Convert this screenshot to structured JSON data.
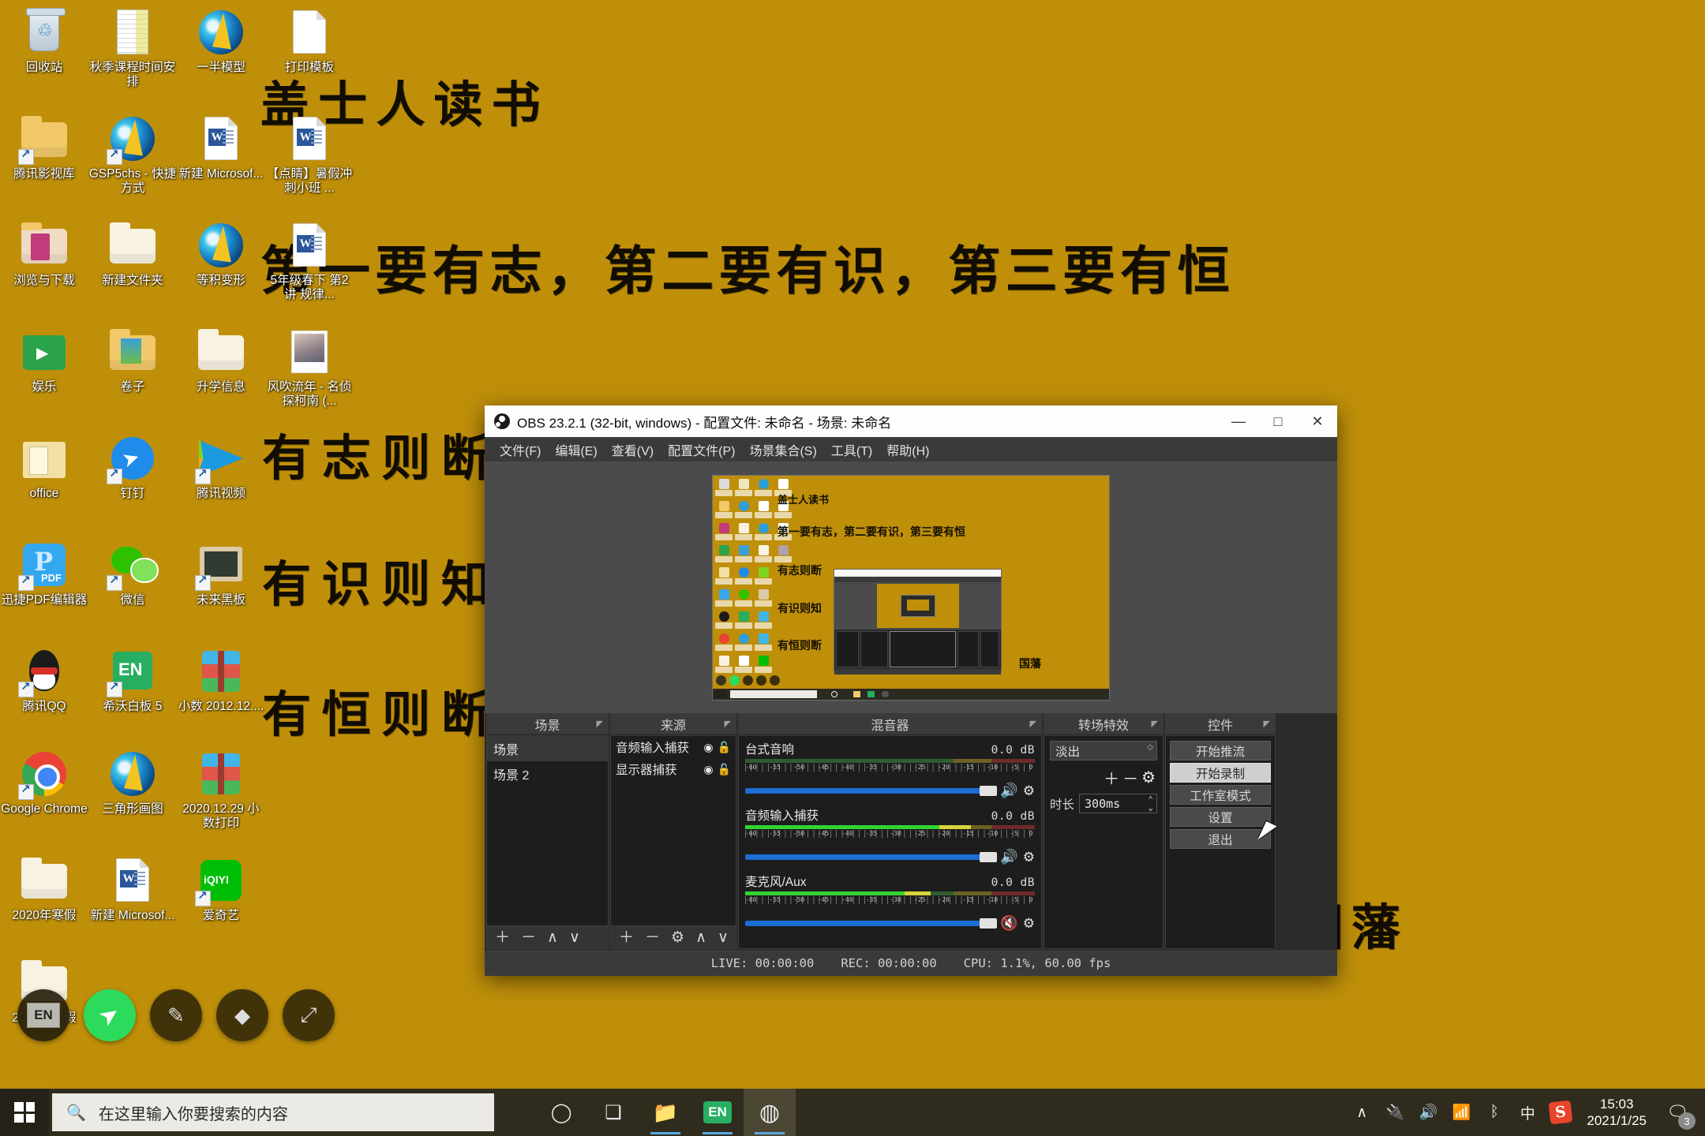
{
  "desktop": {
    "wallpaper_color": "#bf8f0a",
    "calligraphy": {
      "title": "盖士人读书",
      "line1": "第一要有志，第二要有识，第三要有恒",
      "line2": "有志则断",
      "line3": "有识则知",
      "line4": "有恒则断",
      "signature": "国藩"
    },
    "icons": [
      {
        "label": "回收站",
        "icon": "recycle-bin-icon"
      },
      {
        "label": "秋季课程时间安排",
        "icon": "spreadsheet-icon"
      },
      {
        "label": "一半模型",
        "icon": "gsp-icon"
      },
      {
        "label": "打印模板",
        "icon": "document-icon"
      },
      {
        "label": "腾讯影视库",
        "icon": "folder-shortcut-icon"
      },
      {
        "label": "GSP5chs - 快捷方式",
        "icon": "gsp-shortcut-icon"
      },
      {
        "label": "新建 Microsof...",
        "icon": "word-doc-icon"
      },
      {
        "label": "【点睛】暑假冲刺小班 ...",
        "icon": "word-doc-icon"
      },
      {
        "label": "浏览与下载",
        "icon": "folder-pink-icon"
      },
      {
        "label": "新建文件夹",
        "icon": "folder-white-icon"
      },
      {
        "label": "等积变形",
        "icon": "gsp-icon"
      },
      {
        "label": "5年级春下 第2讲 规律...",
        "icon": "word-doc-icon"
      },
      {
        "label": "娱乐",
        "icon": "folder-green-icon"
      },
      {
        "label": "卷子",
        "icon": "folder-photos-icon"
      },
      {
        "label": "升学信息",
        "icon": "folder-white-icon"
      },
      {
        "label": "风吹流年 - 名侦探柯南 (...",
        "icon": "photo-icon"
      },
      {
        "label": "office",
        "icon": "folder-office-icon"
      },
      {
        "label": "钉钉",
        "icon": "dingtalk-icon"
      },
      {
        "label": "腾讯视频",
        "icon": "tencent-video-icon"
      },
      {
        "label": "迅捷PDF编辑器",
        "icon": "pdf-editor-icon"
      },
      {
        "label": "微信",
        "icon": "wechat-icon"
      },
      {
        "label": "未来黑板",
        "icon": "blackboard-icon"
      },
      {
        "label": "腾讯QQ",
        "icon": "qq-icon"
      },
      {
        "label": "希沃白板 5",
        "icon": "seewo-icon"
      },
      {
        "label": "小数 2012.12....",
        "icon": "winrar-icon"
      },
      {
        "label": "Google Chrome",
        "icon": "chrome-icon"
      },
      {
        "label": "三角形画图",
        "icon": "gsp-icon"
      },
      {
        "label": "2020.12.29 小数打印",
        "icon": "winrar-icon"
      },
      {
        "label": "2020年寒假",
        "icon": "folder-white-icon"
      },
      {
        "label": "新建 Microsof...",
        "icon": "word-doc-icon"
      },
      {
        "label": "爱奇艺",
        "icon": "iqiyi-icon"
      },
      {
        "label": "2021年寒假",
        "icon": "folder-white-icon"
      }
    ],
    "pen_toolbar": [
      {
        "name": "ime-toggle",
        "glyph": "EN"
      },
      {
        "name": "cursor-tool",
        "glyph": "➤"
      },
      {
        "name": "pen-tool",
        "glyph": "✎"
      },
      {
        "name": "eraser-tool",
        "glyph": "◆"
      },
      {
        "name": "fullscreen-tool",
        "glyph": "⤢"
      }
    ]
  },
  "obs": {
    "title": "OBS 23.2.1 (32-bit, windows) - 配置文件: 未命名 - 场景: 未命名",
    "window_buttons": {
      "minimize": "—",
      "maximize": "□",
      "close": "✕"
    },
    "menu": [
      "文件(F)",
      "编辑(E)",
      "查看(V)",
      "配置文件(P)",
      "场景集合(S)",
      "工具(T)",
      "帮助(H)"
    ],
    "panels": {
      "scenes": {
        "title": "场景",
        "items": [
          "场景",
          "场景 2"
        ],
        "selected": "场景",
        "footer": [
          "＋",
          "－",
          "∧",
          "∨"
        ]
      },
      "sources": {
        "title": "来源",
        "items": [
          {
            "name": "音频输入捕获",
            "visible": "◉",
            "locked": "🔓"
          },
          {
            "name": "显示器捕获",
            "visible": "◉",
            "locked": "🔓"
          }
        ],
        "footer": [
          "＋",
          "－",
          "⚙",
          "∧",
          "∨"
        ]
      },
      "mixer": {
        "title": "混音器",
        "tick_labels": [
          "-60",
          "-55",
          "-50",
          "-45",
          "-40",
          "-35",
          "-30",
          "-25",
          "-20",
          "-15",
          "-10",
          "-5",
          "0"
        ],
        "channels": [
          {
            "name": "台式音响",
            "db": "0.0 dB",
            "muted": false,
            "level_pct": 0
          },
          {
            "name": "音频输入捕获",
            "db": "0.0 dB",
            "muted": false,
            "level_pct": 78
          },
          {
            "name": "麦克风/Aux",
            "db": "0.0 dB",
            "muted": true,
            "level_pct": 64
          }
        ]
      },
      "transitions": {
        "title": "转场特效",
        "selected": "淡出",
        "buttons": [
          "＋",
          "－",
          "⚙"
        ],
        "duration_label": "时长",
        "duration_value": "300ms"
      },
      "controls": {
        "title": "控件",
        "buttons": [
          {
            "label": "开始推流",
            "hover": false
          },
          {
            "label": "开始录制",
            "hover": true
          },
          {
            "label": "工作室模式",
            "hover": false
          },
          {
            "label": "设置",
            "hover": false
          },
          {
            "label": "退出",
            "hover": false
          }
        ]
      }
    },
    "status": {
      "live": "LIVE: 00:00:00",
      "rec": "REC: 00:00:00",
      "cpu": "CPU: 1.1%, 60.00 fps"
    }
  },
  "taskbar": {
    "search_placeholder": "在这里输入你要搜索的内容",
    "apps": [
      {
        "name": "cortana-icon",
        "glyph": "◯"
      },
      {
        "name": "task-view-icon",
        "glyph": "❏"
      },
      {
        "name": "file-explorer-icon",
        "glyph": "📁"
      },
      {
        "name": "seewo-icon",
        "glyph": "EN"
      },
      {
        "name": "obs-icon",
        "glyph": "◍"
      }
    ],
    "tray": [
      {
        "name": "show-hidden-icons",
        "glyph": "∧"
      },
      {
        "name": "battery-icon",
        "glyph": "🔌"
      },
      {
        "name": "volume-icon",
        "glyph": "🔊"
      },
      {
        "name": "wifi-icon",
        "glyph": "📶"
      },
      {
        "name": "bluetooth-icon",
        "glyph": "ᛒ"
      },
      {
        "name": "ime-chinese-icon",
        "glyph": "中"
      },
      {
        "name": "sogou-icon",
        "glyph": "S"
      }
    ],
    "clock": {
      "time": "15:03",
      "date": "2021/1/25"
    },
    "notifications_count": "3"
  }
}
